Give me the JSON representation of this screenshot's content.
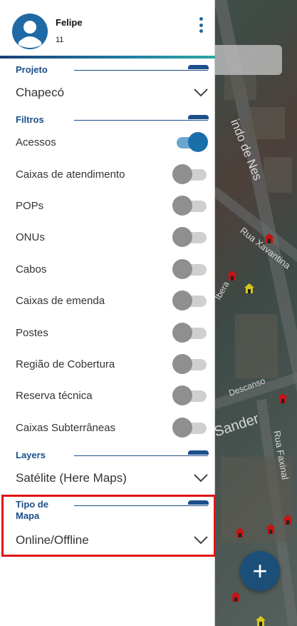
{
  "user": {
    "name": "Felipe",
    "subtitle": "11"
  },
  "sections": {
    "projeto": {
      "title": "Projeto",
      "value": "Chapecó"
    },
    "filtros": {
      "title": "Filtros",
      "items": [
        {
          "label": "Acessos",
          "on": true
        },
        {
          "label": "Caixas de atendimento",
          "on": false
        },
        {
          "label": "POPs",
          "on": false
        },
        {
          "label": "ONUs",
          "on": false
        },
        {
          "label": "Cabos",
          "on": false
        },
        {
          "label": "Caixas de emenda",
          "on": false
        },
        {
          "label": "Postes",
          "on": false
        },
        {
          "label": "Região de Cobertura",
          "on": false
        },
        {
          "label": "Reserva técnica",
          "on": false
        },
        {
          "label": "Caixas Subterrâneas",
          "on": false
        }
      ]
    },
    "layers": {
      "title": "Layers",
      "value": "Satélite (Here Maps)"
    },
    "tipo_mapa": {
      "title_line1": "Tipo de",
      "title_line2": "Mapa",
      "value": "Online/Offline"
    }
  },
  "map": {
    "street_labels": [
      "indo de Nes",
      "Rua Xavantina",
      "Sander",
      "Rua Faxinal",
      "Descanso",
      "Ibera"
    ]
  },
  "icons": {
    "avatar": "person-icon",
    "menu": "more-vert-icon",
    "chevron": "chevron-down-icon",
    "fab": "plus-icon",
    "map_pin": "house-pin-icon"
  },
  "colors": {
    "accent": "#1b4f8a",
    "toggle_on": "#1a6fa8",
    "highlight": "#e01616",
    "fab": "#1b4f78"
  }
}
